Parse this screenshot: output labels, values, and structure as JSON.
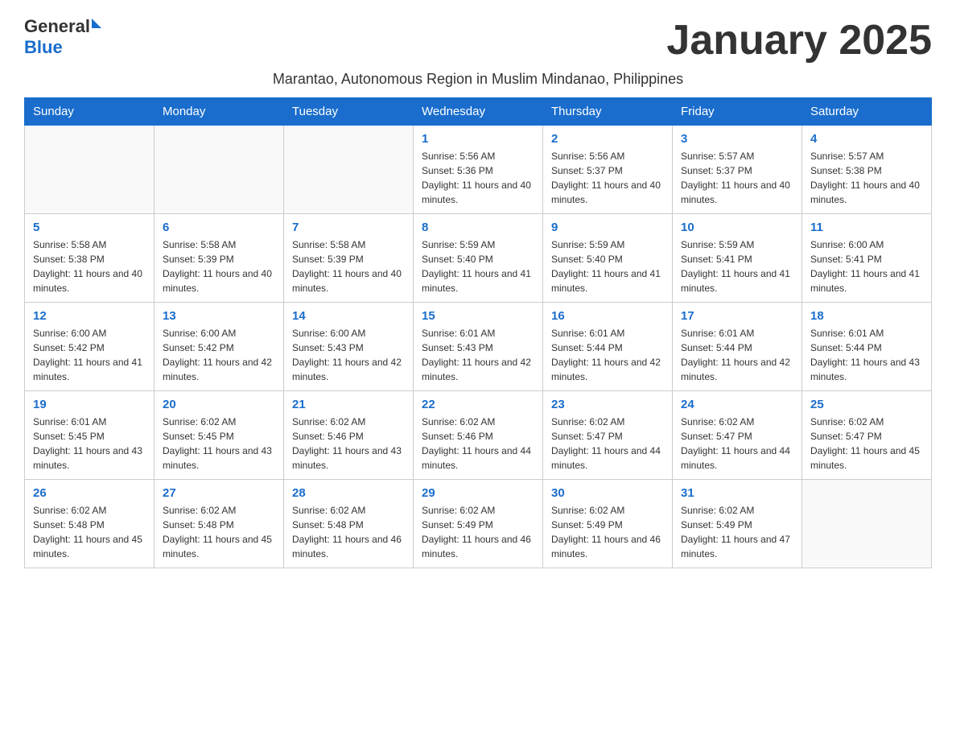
{
  "header": {
    "logo_general": "General",
    "logo_blue": "Blue",
    "month_title": "January 2025",
    "subtitle": "Marantao, Autonomous Region in Muslim Mindanao, Philippines"
  },
  "days_of_week": [
    "Sunday",
    "Monday",
    "Tuesday",
    "Wednesday",
    "Thursday",
    "Friday",
    "Saturday"
  ],
  "weeks": [
    [
      {
        "day": "",
        "info": ""
      },
      {
        "day": "",
        "info": ""
      },
      {
        "day": "",
        "info": ""
      },
      {
        "day": "1",
        "info": "Sunrise: 5:56 AM\nSunset: 5:36 PM\nDaylight: 11 hours and 40 minutes."
      },
      {
        "day": "2",
        "info": "Sunrise: 5:56 AM\nSunset: 5:37 PM\nDaylight: 11 hours and 40 minutes."
      },
      {
        "day": "3",
        "info": "Sunrise: 5:57 AM\nSunset: 5:37 PM\nDaylight: 11 hours and 40 minutes."
      },
      {
        "day": "4",
        "info": "Sunrise: 5:57 AM\nSunset: 5:38 PM\nDaylight: 11 hours and 40 minutes."
      }
    ],
    [
      {
        "day": "5",
        "info": "Sunrise: 5:58 AM\nSunset: 5:38 PM\nDaylight: 11 hours and 40 minutes."
      },
      {
        "day": "6",
        "info": "Sunrise: 5:58 AM\nSunset: 5:39 PM\nDaylight: 11 hours and 40 minutes."
      },
      {
        "day": "7",
        "info": "Sunrise: 5:58 AM\nSunset: 5:39 PM\nDaylight: 11 hours and 40 minutes."
      },
      {
        "day": "8",
        "info": "Sunrise: 5:59 AM\nSunset: 5:40 PM\nDaylight: 11 hours and 41 minutes."
      },
      {
        "day": "9",
        "info": "Sunrise: 5:59 AM\nSunset: 5:40 PM\nDaylight: 11 hours and 41 minutes."
      },
      {
        "day": "10",
        "info": "Sunrise: 5:59 AM\nSunset: 5:41 PM\nDaylight: 11 hours and 41 minutes."
      },
      {
        "day": "11",
        "info": "Sunrise: 6:00 AM\nSunset: 5:41 PM\nDaylight: 11 hours and 41 minutes."
      }
    ],
    [
      {
        "day": "12",
        "info": "Sunrise: 6:00 AM\nSunset: 5:42 PM\nDaylight: 11 hours and 41 minutes."
      },
      {
        "day": "13",
        "info": "Sunrise: 6:00 AM\nSunset: 5:42 PM\nDaylight: 11 hours and 42 minutes."
      },
      {
        "day": "14",
        "info": "Sunrise: 6:00 AM\nSunset: 5:43 PM\nDaylight: 11 hours and 42 minutes."
      },
      {
        "day": "15",
        "info": "Sunrise: 6:01 AM\nSunset: 5:43 PM\nDaylight: 11 hours and 42 minutes."
      },
      {
        "day": "16",
        "info": "Sunrise: 6:01 AM\nSunset: 5:44 PM\nDaylight: 11 hours and 42 minutes."
      },
      {
        "day": "17",
        "info": "Sunrise: 6:01 AM\nSunset: 5:44 PM\nDaylight: 11 hours and 42 minutes."
      },
      {
        "day": "18",
        "info": "Sunrise: 6:01 AM\nSunset: 5:44 PM\nDaylight: 11 hours and 43 minutes."
      }
    ],
    [
      {
        "day": "19",
        "info": "Sunrise: 6:01 AM\nSunset: 5:45 PM\nDaylight: 11 hours and 43 minutes."
      },
      {
        "day": "20",
        "info": "Sunrise: 6:02 AM\nSunset: 5:45 PM\nDaylight: 11 hours and 43 minutes."
      },
      {
        "day": "21",
        "info": "Sunrise: 6:02 AM\nSunset: 5:46 PM\nDaylight: 11 hours and 43 minutes."
      },
      {
        "day": "22",
        "info": "Sunrise: 6:02 AM\nSunset: 5:46 PM\nDaylight: 11 hours and 44 minutes."
      },
      {
        "day": "23",
        "info": "Sunrise: 6:02 AM\nSunset: 5:47 PM\nDaylight: 11 hours and 44 minutes."
      },
      {
        "day": "24",
        "info": "Sunrise: 6:02 AM\nSunset: 5:47 PM\nDaylight: 11 hours and 44 minutes."
      },
      {
        "day": "25",
        "info": "Sunrise: 6:02 AM\nSunset: 5:47 PM\nDaylight: 11 hours and 45 minutes."
      }
    ],
    [
      {
        "day": "26",
        "info": "Sunrise: 6:02 AM\nSunset: 5:48 PM\nDaylight: 11 hours and 45 minutes."
      },
      {
        "day": "27",
        "info": "Sunrise: 6:02 AM\nSunset: 5:48 PM\nDaylight: 11 hours and 45 minutes."
      },
      {
        "day": "28",
        "info": "Sunrise: 6:02 AM\nSunset: 5:48 PM\nDaylight: 11 hours and 46 minutes."
      },
      {
        "day": "29",
        "info": "Sunrise: 6:02 AM\nSunset: 5:49 PM\nDaylight: 11 hours and 46 minutes."
      },
      {
        "day": "30",
        "info": "Sunrise: 6:02 AM\nSunset: 5:49 PM\nDaylight: 11 hours and 46 minutes."
      },
      {
        "day": "31",
        "info": "Sunrise: 6:02 AM\nSunset: 5:49 PM\nDaylight: 11 hours and 47 minutes."
      },
      {
        "day": "",
        "info": ""
      }
    ]
  ]
}
